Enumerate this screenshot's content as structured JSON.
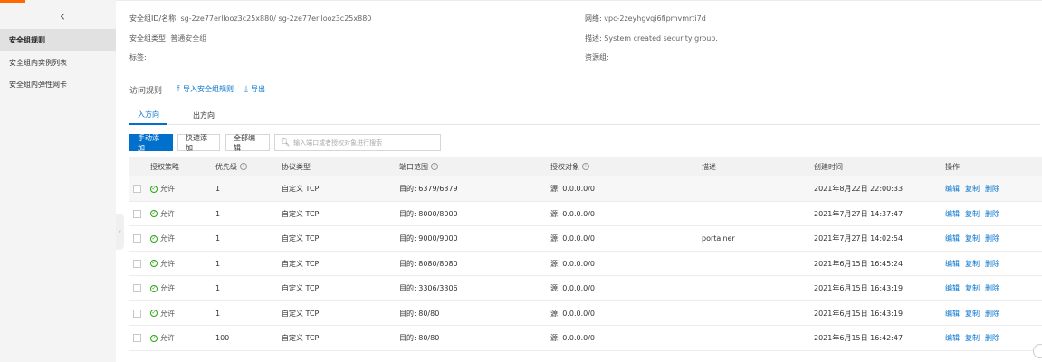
{
  "sidebar": {
    "back_icon": "‹",
    "items": [
      {
        "label": "安全组规则",
        "active": true
      },
      {
        "label": "安全组内实例列表",
        "active": false
      },
      {
        "label": "安全组内弹性网卡",
        "active": false
      }
    ]
  },
  "info": {
    "id_label": "安全组ID/名称:",
    "id_value": "sg-2ze77erllooz3c25x880/ sg-2ze77erllooz3c25x880",
    "type_label": "安全组类型:",
    "type_value": "普通安全组",
    "tag_label": "标签:",
    "network_label": "网络:",
    "network_value": "vpc-2zeyhgvqi6fipmvmrti7d",
    "desc_label": "描述:",
    "desc_value": "System created security group.",
    "resource_group_label": "资源组:"
  },
  "rules": {
    "title": "访问规则",
    "import_label": "导入安全组规则",
    "export_label": "导出"
  },
  "tabs": [
    {
      "label": "入方向",
      "active": true
    },
    {
      "label": "出方向",
      "active": false
    }
  ],
  "toolbar": {
    "manual_add": "手动添加",
    "quick_add": "快速添加",
    "edit_all": "全部编辑",
    "search_placeholder": "输入端口或者授权对象进行搜索"
  },
  "table": {
    "headers": {
      "policy": "授权策略",
      "priority": "优先级",
      "protocol": "协议类型",
      "port": "端口范围",
      "auth": "授权对象",
      "desc": "描述",
      "created": "创建时间",
      "ops": "操作"
    },
    "ops": {
      "edit": "编辑",
      "copy": "复制",
      "delete": "删除"
    },
    "rows": [
      {
        "policy": "允许",
        "priority": "1",
        "protocol": "自定义 TCP",
        "port": "目的: 6379/6379",
        "auth": "源: 0.0.0.0/0",
        "desc": "",
        "created": "2021年8月22日 22:00:33"
      },
      {
        "policy": "允许",
        "priority": "1",
        "protocol": "自定义 TCP",
        "port": "目的: 8000/8000",
        "auth": "源: 0.0.0.0/0",
        "desc": "",
        "created": "2021年7月27日 14:37:47"
      },
      {
        "policy": "允许",
        "priority": "1",
        "protocol": "自定义 TCP",
        "port": "目的: 9000/9000",
        "auth": "源: 0.0.0.0/0",
        "desc": "portainer",
        "created": "2021年7月27日 14:02:54"
      },
      {
        "policy": "允许",
        "priority": "1",
        "protocol": "自定义 TCP",
        "port": "目的: 8080/8080",
        "auth": "源: 0.0.0.0/0",
        "desc": "",
        "created": "2021年6月15日 16:45:24"
      },
      {
        "policy": "允许",
        "priority": "1",
        "protocol": "自定义 TCP",
        "port": "目的: 3306/3306",
        "auth": "源: 0.0.0.0/0",
        "desc": "",
        "created": "2021年6月15日 16:43:19"
      },
      {
        "policy": "允许",
        "priority": "1",
        "protocol": "自定义 TCP",
        "port": "目的: 80/80",
        "auth": "源: 0.0.0.0/0",
        "desc": "",
        "created": "2021年6月15日 16:43:19"
      },
      {
        "policy": "允许",
        "priority": "100",
        "protocol": "自定义 TCP",
        "port": "目的: 80/80",
        "auth": "源: 0.0.0.0/0",
        "desc": "",
        "created": "2021年6月15日 16:42:47"
      }
    ]
  }
}
